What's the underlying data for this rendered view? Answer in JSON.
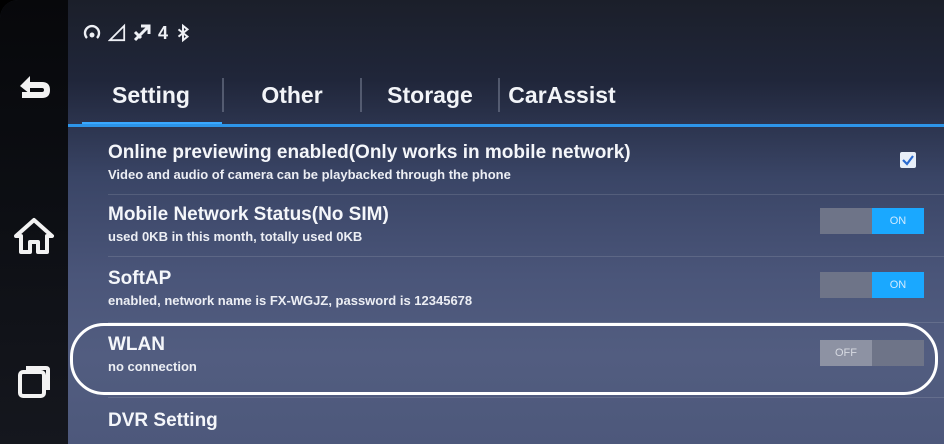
{
  "status_bar": {
    "notification_count": "4"
  },
  "tabs": [
    {
      "label": "Setting",
      "active": true
    },
    {
      "label": "Other",
      "active": false
    },
    {
      "label": "Storage",
      "active": false
    },
    {
      "label": "CarAssist",
      "active": false
    }
  ],
  "settings": [
    {
      "title": "Online previewing enabled(Only works in mobile network)",
      "subtitle": "Video and audio of camera can be playbacked through the phone",
      "control": "checkbox",
      "checked": true
    },
    {
      "title": "Mobile Network Status(No SIM)",
      "subtitle": "used 0KB in this month, totally used 0KB",
      "control": "toggle",
      "state": "ON"
    },
    {
      "title": "SoftAP",
      "subtitle": "enabled, network name is FX-WGJZ, password is 12345678",
      "control": "toggle",
      "state": "ON"
    },
    {
      "title": "WLAN",
      "subtitle": "no connection",
      "control": "toggle",
      "state": "OFF"
    },
    {
      "title": "DVR Setting"
    }
  ],
  "colors": {
    "accent": "#2d95e8",
    "toggle_on": "#1aa8ff",
    "highlight_outline": "#ffffff"
  },
  "icons": {
    "back": "back-arrow-icon",
    "home": "home-icon",
    "recents": "recent-apps-icon"
  }
}
